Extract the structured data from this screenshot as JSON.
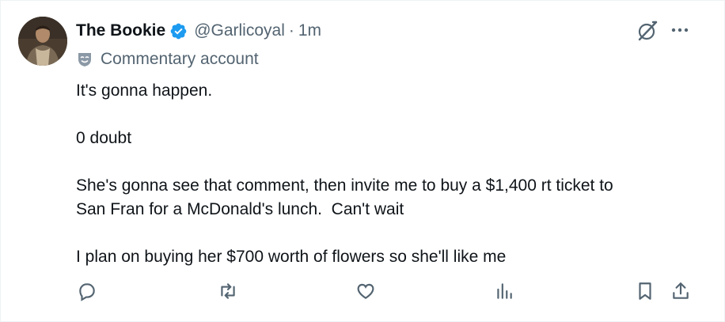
{
  "post": {
    "author_name": "The Bookie",
    "author_handle": "@Garlicoyal",
    "separator": "·",
    "timestamp": "1m",
    "account_label": "Commentary account",
    "text_lines": [
      "It's gonna happen.",
      "",
      "0 doubt",
      "",
      "She's gonna see that comment, then invite me to buy a $1,400 rt ticket to",
      "San Fran for a McDonald's lunch.  Can't wait",
      "",
      "I plan on buying her $700 worth of flowers so she'll like me"
    ],
    "verified": true
  },
  "icons": {
    "avatar": "avatar",
    "verified": "verified-badge-icon",
    "grok": "grok-icon",
    "more": "more-icon",
    "label": "commentary-mask-icon",
    "reply": "reply-icon",
    "repost": "repost-icon",
    "like": "like-icon",
    "views": "views-icon",
    "bookmark": "bookmark-icon",
    "share": "share-icon"
  },
  "colors": {
    "text": "#0f1419",
    "secondary": "#536471",
    "verified": "#1d9bf0"
  }
}
